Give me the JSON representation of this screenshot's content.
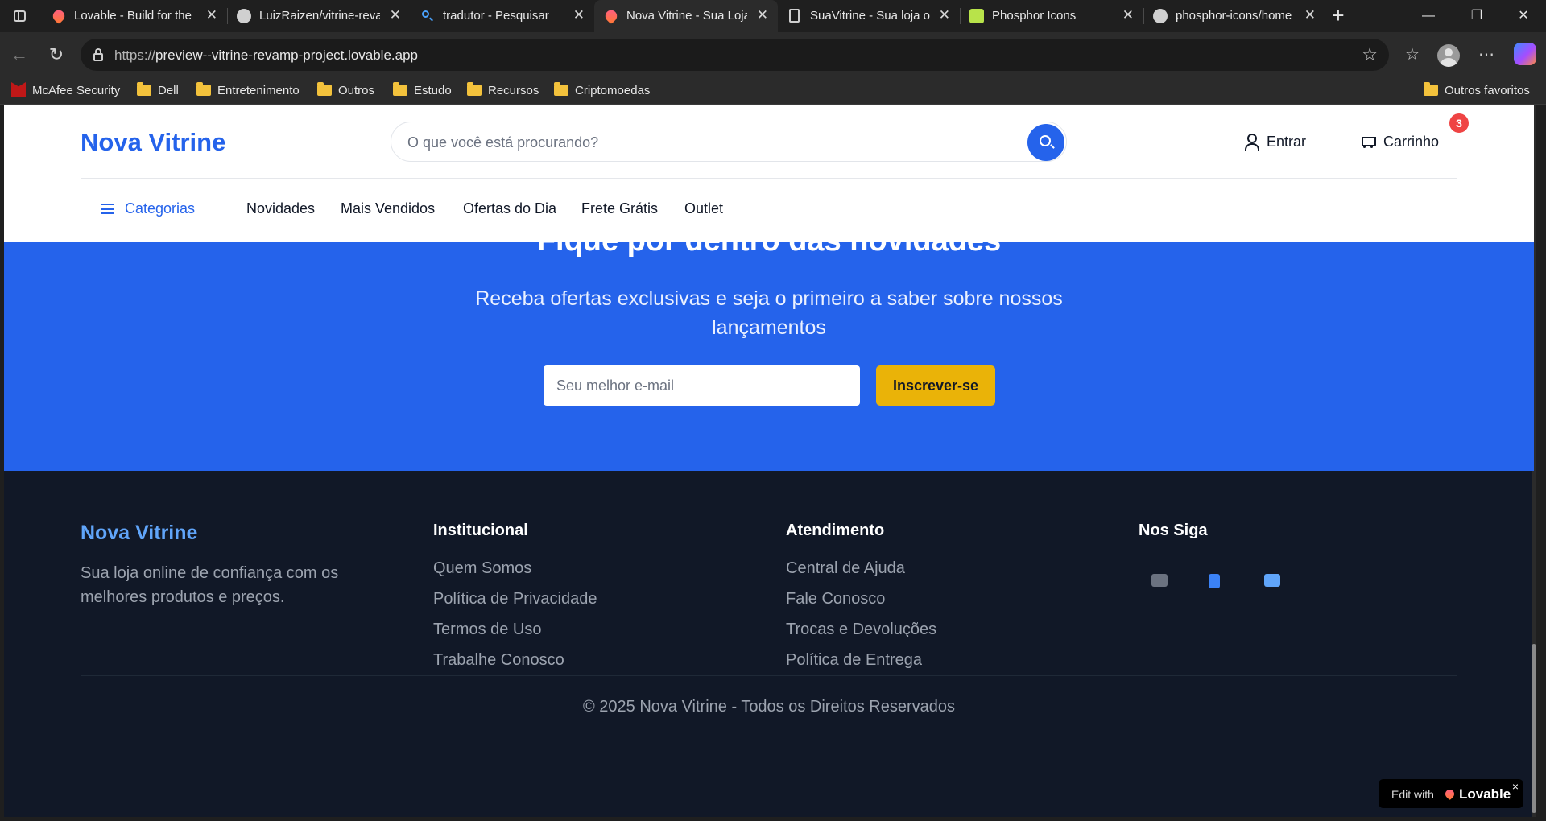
{
  "browser": {
    "tabs": [
      {
        "title": "Lovable - Build for the",
        "favicon": "lovable-heart-icon"
      },
      {
        "title": "LuizRaizen/vitrine-reva",
        "favicon": "github-icon"
      },
      {
        "title": "tradutor - Pesquisar",
        "favicon": "search-icon"
      },
      {
        "title": "Nova Vitrine - Sua Loja",
        "favicon": "lovable-heart-icon",
        "active": true
      },
      {
        "title": "SuaVitrine - Sua loja o",
        "favicon": "document-icon"
      },
      {
        "title": "Phosphor Icons",
        "favicon": "phosphor-icon"
      },
      {
        "title": "phosphor-icons/home",
        "favicon": "github-icon"
      }
    ],
    "tab_close": "✕",
    "new_tab": "+",
    "window_controls": {
      "minimize": "—",
      "maximize": "❐",
      "close": "✕"
    },
    "url_prefix": "https://",
    "url_host": "preview--vitrine-revamp-project.lovable.app",
    "bookmarks": [
      "McAfee Security",
      "Dell",
      "Entretenimento",
      "Outros",
      "Estudo",
      "Recursos",
      "Criptomoedas"
    ],
    "other_favorites": "Outros favoritos"
  },
  "site": {
    "logo": "Nova Vitrine",
    "search_placeholder": "O que você está procurando?",
    "login_label": "Entrar",
    "cart_label": "Carrinho",
    "cart_count": "3",
    "categories_label": "Categorias",
    "nav": [
      "Novidades",
      "Mais Vendidos",
      "Ofertas do Dia",
      "Frete Grátis",
      "Outlet"
    ]
  },
  "newsletter": {
    "title": "Fique por dentro das novidades",
    "subtitle": "Receba ofertas exclusivas e seja o primeiro a saber sobre nossos lançamentos",
    "email_placeholder": "Seu melhor e-mail",
    "button": "Inscrever-se"
  },
  "footer": {
    "logo": "Nova Vitrine",
    "about": "Sua loja online de confiança com os melhores produtos e preços.",
    "columns": [
      {
        "title": "Institucional",
        "links": [
          "Quem Somos",
          "Política de Privacidade",
          "Termos de Uso",
          "Trabalhe Conosco"
        ]
      },
      {
        "title": "Atendimento",
        "links": [
          "Central de Ajuda",
          "Fale Conosco",
          "Trocas e Devoluções",
          "Política de Entrega"
        ]
      }
    ],
    "social_title": "Nos Siga",
    "social": [
      {
        "icon": "camera-icon",
        "color": "#6b7280"
      },
      {
        "icon": "book-icon",
        "color": "#3b82f6"
      },
      {
        "icon": "tv-icon",
        "color": "#60a5fa"
      }
    ],
    "copyright": "© 2025 Nova Vitrine - Todos os Direitos Reservados"
  },
  "lovable_badge": {
    "text": "Edit with",
    "brand": "Lovable",
    "close": "×"
  },
  "colors": {
    "primary": "#2563eb",
    "accent": "#eab308",
    "footer_bg": "#111827",
    "badge": "#ef4444"
  }
}
